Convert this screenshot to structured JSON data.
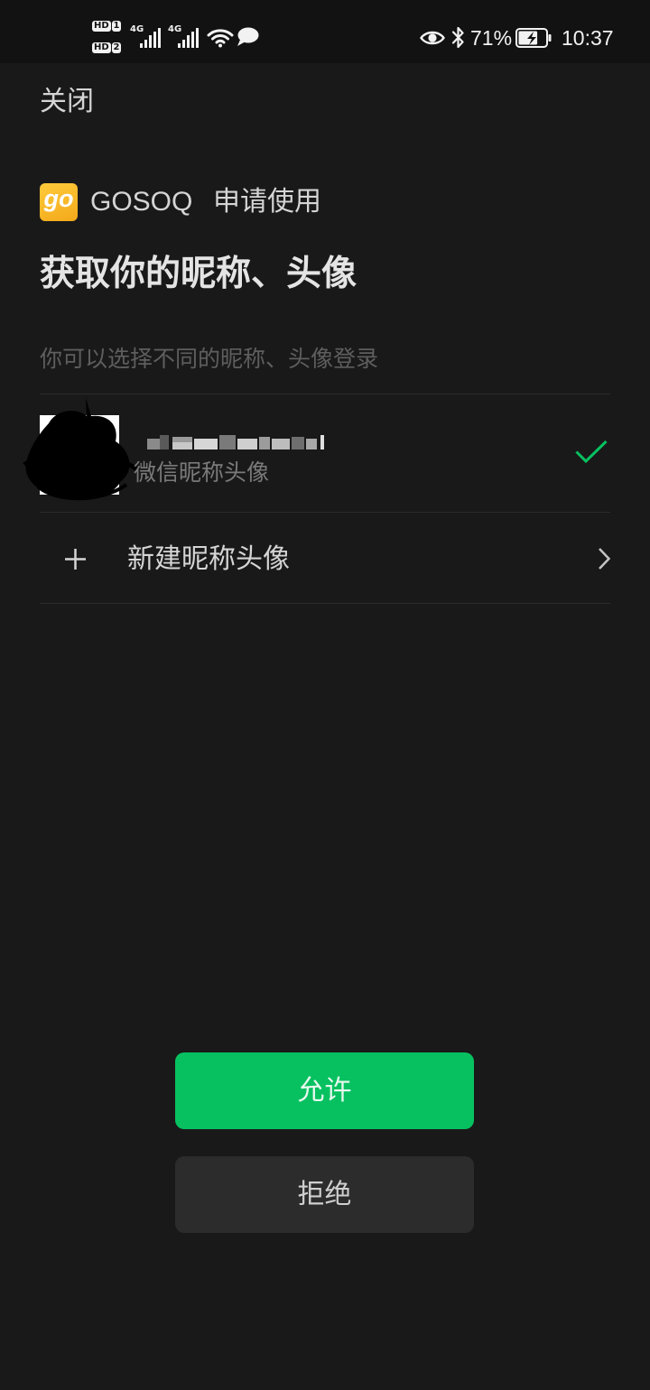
{
  "status_bar": {
    "sim1_badge": "HD",
    "sim1_number": "1",
    "sim2_badge": "HD",
    "sim2_number": "2",
    "network1": "4G",
    "network2": "4G",
    "battery_percent": "71%",
    "battery_level": 0.71,
    "time": "10:37",
    "icons": [
      "signal-icon",
      "wifi-icon",
      "message-icon",
      "eye-icon",
      "bluetooth-icon",
      "battery-charging-icon"
    ]
  },
  "header": {
    "close_label": "关闭"
  },
  "app": {
    "logo_text": "go",
    "name": "GOSOQ",
    "request_text": "申请使用"
  },
  "title": "获取你的昵称、头像",
  "subtitle": "你可以选择不同的昵称、头像登录",
  "profiles": [
    {
      "source_label": "微信昵称头像",
      "selected": true
    }
  ],
  "new_profile": {
    "label": "新建昵称头像",
    "icons": [
      "plus-icon",
      "chevron-right-icon"
    ]
  },
  "actions": {
    "allow_label": "允许",
    "deny_label": "拒绝"
  },
  "colors": {
    "background": "#191919",
    "status_bar": "#121212",
    "accent": "#07c160",
    "deny_button": "#2c2c2c"
  }
}
